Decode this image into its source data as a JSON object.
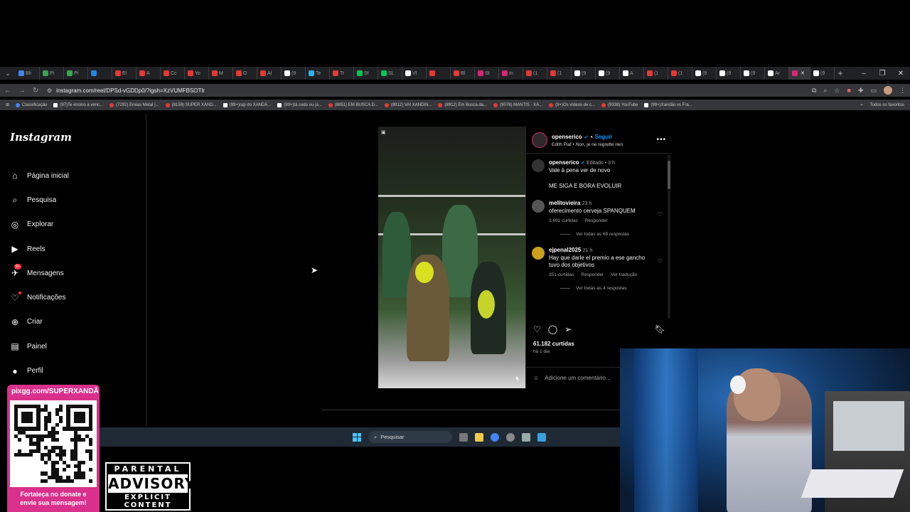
{
  "browser": {
    "tabs": [
      "Bli",
      "Pi",
      "Pi",
      "",
      "El",
      "A",
      "Cc",
      "Yo",
      "M",
      "O",
      "Al",
      "(9",
      "Te",
      "Tr",
      "St",
      "SL",
      "VI",
      "",
      "Bl",
      "St",
      "In",
      "(1",
      "(1",
      "(9",
      "(9",
      "A",
      "(1",
      "(1",
      "(9",
      "(9",
      "(9",
      "Ar",
      "",
      "(9"
    ],
    "url": "instagram.com/reel/DPSd-vGDDp0/?igsh=XzVUMFBSOTlr",
    "bookmarks": [
      "Classificação",
      "(97)Te ensino a venc...",
      "(7292) Enéas Metal |...",
      "(8159) SUPER XAND...",
      "(99+)rap do XANDÃ...",
      "(99+)tá cedo ou já...",
      "(8851) EM BUSCA D...",
      "(8912) VAI XANDIN...",
      "(8912) Em Busca da...",
      "(9078) MANTIS · XA...",
      "(9+)Os vídeos de c...",
      "(9338) YouTube",
      "(99+)Xandão vs Fra..."
    ],
    "all_bookmarks": "Todos os favoritos"
  },
  "instagram": {
    "logo": "Instagram",
    "nav": [
      {
        "label": "Página inicial",
        "icon": "home-icon"
      },
      {
        "label": "Pesquisa",
        "icon": "search-icon"
      },
      {
        "label": "Explorar",
        "icon": "compass-icon"
      },
      {
        "label": "Reels",
        "icon": "reels-icon"
      },
      {
        "label": "Mensagens",
        "icon": "messenger-icon",
        "badge": "9+"
      },
      {
        "label": "Notificações",
        "icon": "heart-icon"
      },
      {
        "label": "Criar",
        "icon": "plus-icon"
      },
      {
        "label": "Painel",
        "icon": "chart-icon"
      },
      {
        "label": "Perfil",
        "icon": "avatar-icon"
      }
    ],
    "post": {
      "username": "openserico",
      "follow": "Seguir",
      "song": "Edith Piaf • Non, je ne regrette rien",
      "caption_meta": "Editado • 3 h",
      "caption_line1": "Vale à pena ver de novo",
      "caption_line2": "ME SIGA E BORA EVOLUIR",
      "comments": [
        {
          "user": "melitovieira",
          "time": "23 h",
          "text": "oferecimento cerveja SPANQUEM",
          "likes": "3.691 curtidas",
          "reply": "Responder",
          "translate": "",
          "view_replies": "Ver todas as 69 respostas"
        },
        {
          "user": "ejpenal2025",
          "time": "21 h",
          "text": "Hay que darle el premio a ese gancho tuvo dos objetivos",
          "likes": "351 curtidas",
          "reply": "Responder",
          "translate": "Ver tradução",
          "view_replies": "Ver todas as 4 respostas"
        }
      ],
      "likes_total": "61.182 curtidas",
      "date": "há 1 dia",
      "add_comment_placeholder": "Adicione um comentário..."
    }
  },
  "taskbar": {
    "search_label": "Pesquisar"
  },
  "overlay": {
    "qr_url": "pixgg.com/SUPERXANDÃ",
    "qr_text_1": "Fortaleça no donate e",
    "qr_text_2": "envie sua mensagem!",
    "advisory_top": "PARENTAL",
    "advisory_mid": "ADVISORY",
    "advisory_bot": "EXPLICIT CONTENT"
  }
}
